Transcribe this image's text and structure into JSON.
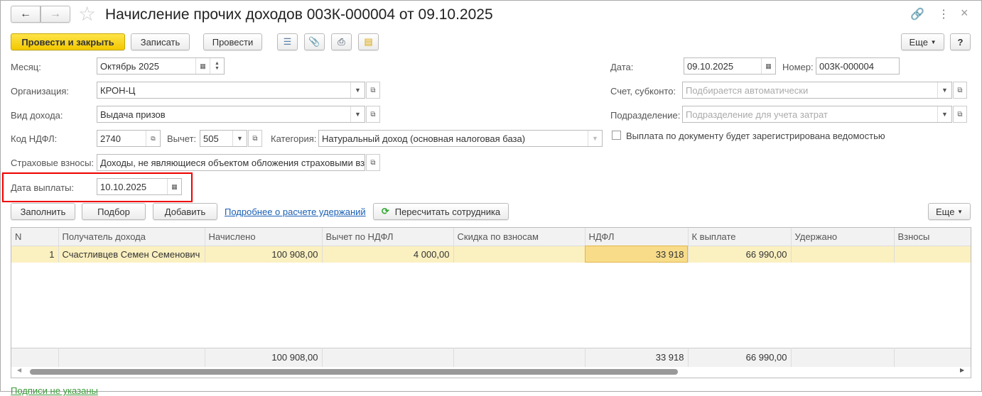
{
  "header": {
    "title": "Начисление прочих доходов 003К-000004 от 09.10.2025"
  },
  "toolbar": {
    "post_close": "Провести и закрыть",
    "save": "Записать",
    "post": "Провести",
    "more": "Еще",
    "help": "?"
  },
  "form": {
    "month_label": "Месяц:",
    "month": "Октябрь 2025",
    "org_label": "Организация:",
    "org": "КРОН-Ц",
    "income_label": "Вид дохода:",
    "income": "Выдача призов",
    "ndfl_code_label": "Код НДФЛ:",
    "ndfl_code": "2740",
    "deduction_label": "Вычет:",
    "deduction": "505",
    "category_label": "Категория:",
    "category": "Натуральный доход (основная налоговая база)",
    "insurance_label": "Страховые взносы:",
    "insurance": "Доходы, не являющиеся объектом обложения страховыми вз",
    "pay_date_label": "Дата выплаты:",
    "pay_date": "10.10.2025",
    "date_label": "Дата:",
    "date": "09.10.2025",
    "number_label": "Номер:",
    "number": "003К-000004",
    "account_label": "Счет, субконто:",
    "account_placeholder": "Подбирается автоматически",
    "dept_label": "Подразделение:",
    "dept_placeholder": "Подразделение для учета затрат",
    "statement_checkbox": "Выплата по документу будет зарегистрирована ведомостью",
    "statement_checked": false
  },
  "table_toolbar": {
    "fill": "Заполнить",
    "pick": "Подбор",
    "add": "Добавить",
    "link": "Подробнее о расчете удержаний",
    "recalc": "Пересчитать сотрудника",
    "more": "Еще"
  },
  "table": {
    "columns": [
      "N",
      "Получатель дохода",
      "Начислено",
      "Вычет по НДФЛ",
      "Скидка по взносам",
      "НДФЛ",
      "К выплате",
      "Удержано",
      "Взносы"
    ],
    "rows": [
      [
        "1",
        "Счастливцев Семен Семенович",
        "100 908,00",
        "4 000,00",
        "",
        "33 918",
        "66 990,00",
        "",
        ""
      ]
    ],
    "totals": [
      "",
      "",
      "100 908,00",
      "",
      "",
      "33 918",
      "66 990,00",
      "",
      ""
    ]
  },
  "footer": {
    "signatures": "Подписи не указаны"
  }
}
